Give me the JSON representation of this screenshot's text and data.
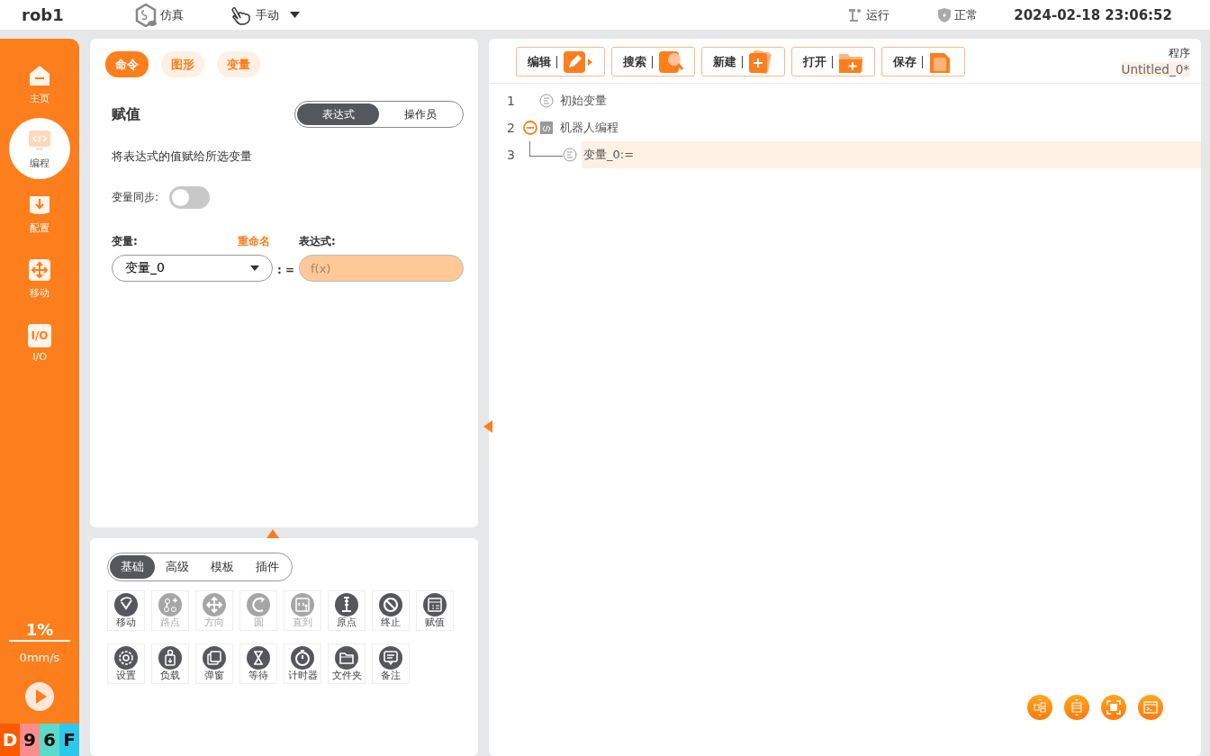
{
  "top_bar": {
    "robot_name": "rob1",
    "mode": "仿真",
    "control": "手动",
    "run_state": "运行",
    "safety": "正常",
    "datetime": "2024-02-18 23:06:52"
  },
  "sidebar": {
    "items": [
      {
        "label": "主页",
        "selected": false
      },
      {
        "label": "编程",
        "selected": true
      },
      {
        "label": "配置",
        "selected": false
      },
      {
        "label": "移动",
        "selected": false
      },
      {
        "label": "I/O",
        "icon_text": "I/O",
        "selected": false
      }
    ],
    "speed": "1%",
    "velocity": "0mm/s",
    "codes": [
      {
        "text": "D",
        "color": "#fb5a00"
      },
      {
        "text": "9",
        "color": "#fd8c8c"
      },
      {
        "text": "6",
        "color": "#5ddbc9"
      },
      {
        "text": "F",
        "color": "#2ec7ec"
      }
    ]
  },
  "command_panel": {
    "tabs": [
      {
        "label": "命令",
        "selected": true
      },
      {
        "label": "图形",
        "selected": false
      },
      {
        "label": "变量",
        "selected": false
      }
    ],
    "title": "赋值",
    "modes": [
      {
        "label": "表达式",
        "selected": true
      },
      {
        "label": "操作员",
        "selected": false
      }
    ],
    "description": "将表达式的值赋给所选变量",
    "sync": {
      "label": "变量同步:",
      "on": false
    },
    "variable_label": "变量:",
    "rename": "重命名",
    "expression_label": "表达式:",
    "variable_value": "变量_0",
    "assign": ": =",
    "expression_placeholder": "f(x)"
  },
  "palette": {
    "tabs": [
      {
        "label": "基础",
        "selected": true
      },
      {
        "label": "高级",
        "selected": false
      },
      {
        "label": "模板",
        "selected": false
      },
      {
        "label": "插件",
        "selected": false
      }
    ],
    "items": [
      {
        "label": "移动",
        "disabled": false
      },
      {
        "label": "路点",
        "disabled": true
      },
      {
        "label": "方向",
        "disabled": true
      },
      {
        "label": "圆",
        "disabled": true
      },
      {
        "label": "直到",
        "disabled": true
      },
      {
        "label": "原点",
        "disabled": false
      },
      {
        "label": "终止",
        "disabled": false
      },
      {
        "label": "赋值",
        "disabled": false
      },
      {
        "label": "设置",
        "disabled": false
      },
      {
        "label": "负载",
        "disabled": false
      },
      {
        "label": "弹窗",
        "disabled": false
      },
      {
        "label": "等待",
        "disabled": false
      },
      {
        "label": "计时器",
        "disabled": false
      },
      {
        "label": "文件夹",
        "disabled": false
      },
      {
        "label": "备注",
        "disabled": false
      }
    ]
  },
  "program": {
    "toolbar": [
      "编辑",
      "搜索",
      "新建",
      "打开",
      "保存"
    ],
    "label": "程序",
    "file": "Untitled_0*",
    "lines": [
      {
        "number": "1",
        "text": "初始变量",
        "selected": false
      },
      {
        "number": "2",
        "text": "机器人编程",
        "expanded": true,
        "selected": false,
        "children": [
          {
            "number": "3",
            "text": "变量_0:=",
            "selected": true
          }
        ]
      }
    ]
  }
}
